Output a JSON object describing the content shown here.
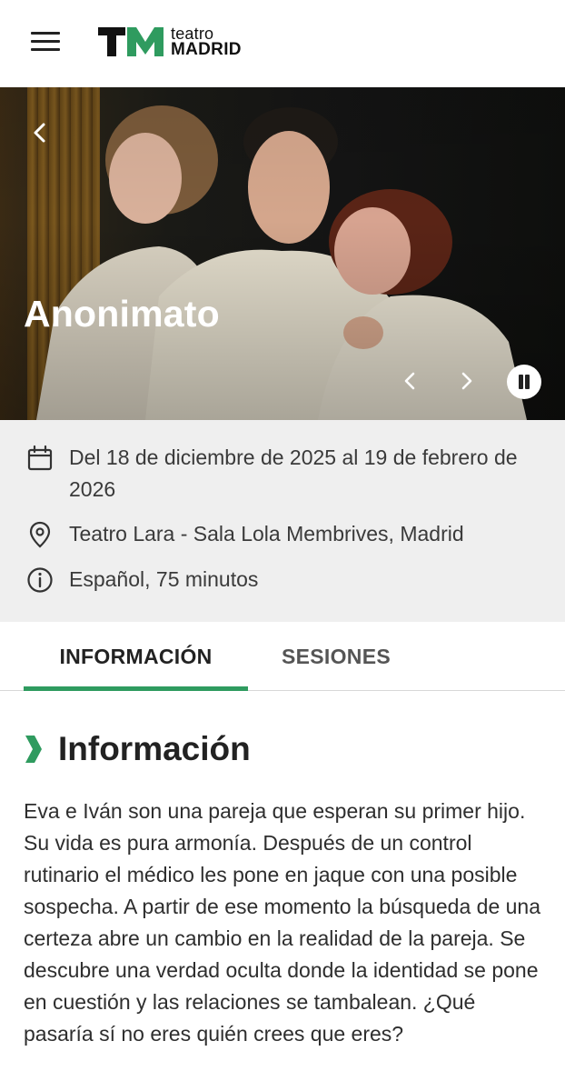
{
  "header": {
    "menu_icon": "hamburger-menu-icon",
    "logo": {
      "line1": "teatro",
      "line2": "MADRID",
      "brand_color": "#2f9b5f"
    }
  },
  "hero": {
    "title": "Anonimato",
    "back_icon": "chevron-left-icon",
    "prev_icon": "chevron-left-icon",
    "next_icon": "chevron-right-icon",
    "pause_icon": "pause-icon"
  },
  "details": {
    "date": "Del 18 de diciembre de 2025 al 19 de febrero de 2026",
    "venue": "Teatro Lara - Sala Lola Membrives, Madrid",
    "info": "Español, 75 minutos",
    "icons": [
      "calendar-icon",
      "location-pin-icon",
      "info-icon"
    ]
  },
  "tabs": [
    {
      "label": "INFORMACIÓN",
      "active": true
    },
    {
      "label": "SESIONES",
      "active": false
    }
  ],
  "section": {
    "title": "Información",
    "description": "Eva e Iván son una pareja que esperan su primer hijo. Su vida es pura armonía. Después de un control rutinario el médico les pone en jaque con una posible sospecha. A partir de ese momento la búsqueda de una certeza abre un cambio en la realidad de la pareja. Se descubre una verdad oculta donde la identidad se pone en cuestión y las relaciones se tambalean. ¿Qué pasaría sí no eres quién crees que eres?"
  },
  "colors": {
    "accent": "#2f9b5f",
    "details_bg": "#efefef"
  }
}
